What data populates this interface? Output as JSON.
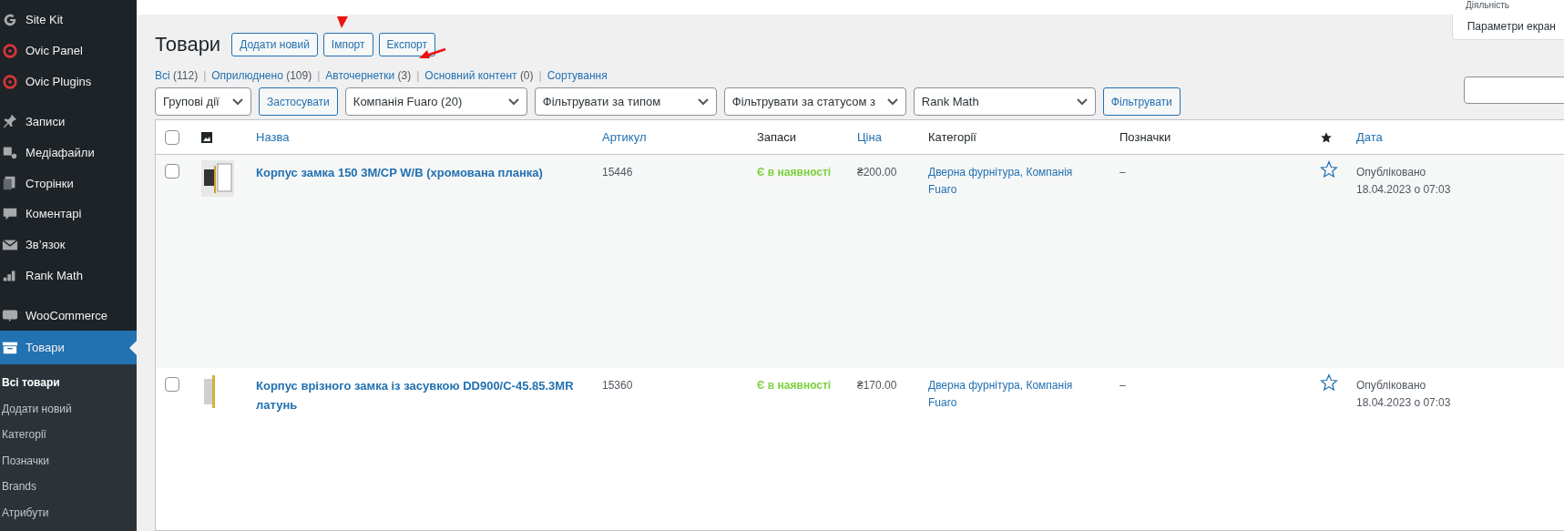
{
  "sidebar": {
    "items": [
      {
        "label": "Site Kit",
        "selected": false,
        "gap_before": false
      },
      {
        "label": "Ovic Panel",
        "selected": false,
        "gap_before": false
      },
      {
        "label": "Ovic Plugins",
        "selected": false,
        "gap_before": false
      },
      {
        "label": "Записи",
        "selected": false,
        "gap_before": true
      },
      {
        "label": "Медіафайли",
        "selected": false,
        "gap_before": false
      },
      {
        "label": "Сторінки",
        "selected": false,
        "gap_before": false
      },
      {
        "label": "Коментарі",
        "selected": false,
        "gap_before": false
      },
      {
        "label": "Зв’язок",
        "selected": false,
        "gap_before": false
      },
      {
        "label": "Rank Math",
        "selected": false,
        "gap_before": false
      },
      {
        "label": "WooCommerce",
        "selected": false,
        "gap_before": true
      },
      {
        "label": "Товари",
        "selected": true,
        "gap_before": false
      }
    ],
    "submenu": [
      {
        "label": "Всі товари",
        "selected": true
      },
      {
        "label": "Додати новий",
        "selected": false
      },
      {
        "label": "Категорії",
        "selected": false
      },
      {
        "label": "Позначки",
        "selected": false
      },
      {
        "label": "Brands",
        "selected": false
      },
      {
        "label": "Атрибути",
        "selected": false
      }
    ]
  },
  "top_tabs": [
    "Діяльність",
    "Параметри екран"
  ],
  "page_title": "Товари",
  "title_buttons": [
    "Додати новий",
    "Імпорт",
    "Експорт"
  ],
  "status_links": [
    {
      "kind": "link",
      "label": "Всі",
      "count": "(112)"
    },
    {
      "kind": "separator",
      "label": "|"
    },
    {
      "kind": "link",
      "label": "Оприлюднено",
      "count": "(109)"
    },
    {
      "kind": "separator",
      "label": "|"
    },
    {
      "kind": "link",
      "label": "Авточернетки",
      "count": "(3)"
    },
    {
      "kind": "separator",
      "label": "|"
    },
    {
      "kind": "link",
      "label": "Основний контент",
      "count": "(0)"
    },
    {
      "kind": "separator",
      "label": "|"
    },
    {
      "kind": "link",
      "label": "Сортування"
    }
  ],
  "filters": [
    {
      "kind": "select",
      "label": "Групові дії"
    },
    {
      "kind": "button",
      "label": "Застосувати"
    },
    {
      "kind": "select",
      "label": "Компанія Fuaro  (20)"
    },
    {
      "kind": "select",
      "label": "Фільтрувати за типом"
    },
    {
      "kind": "select",
      "label": "Фільтрувати за статусом з"
    },
    {
      "kind": "select",
      "label": "Rank Math"
    },
    {
      "kind": "button",
      "label": "Фільтрувати"
    }
  ],
  "table": {
    "select_all_checked": false,
    "columns": [
      {
        "label": "Назва",
        "sortable": true
      },
      {
        "label": "Артикул",
        "sortable": true
      },
      {
        "label": "Запаси",
        "sortable": false
      },
      {
        "label": "Ціна",
        "sortable": true
      },
      {
        "label": "Категорії",
        "sortable": false
      },
      {
        "label": "Позначки",
        "sortable": false
      },
      {
        "label": "Дата",
        "sortable": true
      }
    ],
    "rows": [
      {
        "checked": false,
        "name": "Корпус замка 150 3M/CP W/B (хромована планка)",
        "sku": "15446",
        "stock": "Є в наявності",
        "price": "₴200.00",
        "categories": "Дверна фурнітура, Компанія Fuaro",
        "tags": "–",
        "featured": false,
        "status": "Опубліковано",
        "date": "18.04.2023 о 07:03"
      },
      {
        "checked": false,
        "name": "Корпус врізного замка із засувкою DD900/C-45.85.3MR латунь",
        "sku": "15360",
        "stock": "Є в наявності",
        "price": "₴170.00",
        "categories": "Дверна фурнітура, Компанія Fuaro",
        "tags": "–",
        "featured": false,
        "status": "Опубліковано",
        "date": "18.04.2023 о 07:03"
      }
    ]
  }
}
